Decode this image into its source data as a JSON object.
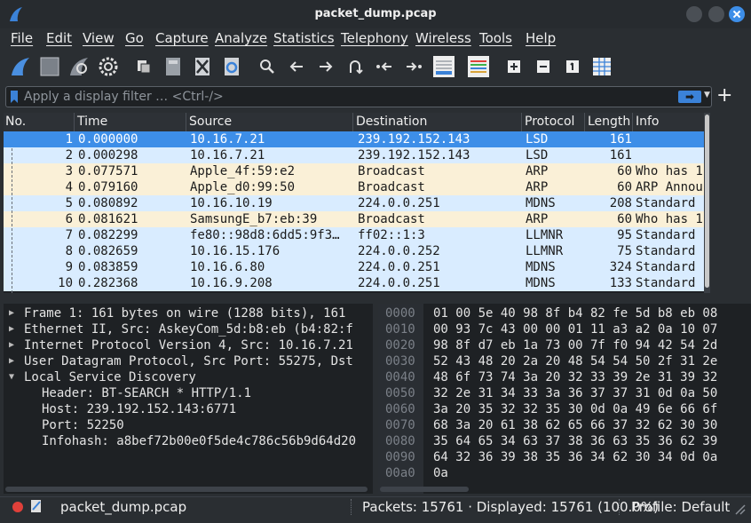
{
  "window": {
    "title": "packet_dump.pcap"
  },
  "menu": [
    "File",
    "Edit",
    "View",
    "Go",
    "Capture",
    "Analyze",
    "Statistics",
    "Telephony",
    "Wireless",
    "Tools",
    "Help"
  ],
  "toolbar": {
    "icons": [
      "shark-fin-start-icon",
      "stop-icon",
      "restart-icon",
      "options-gear-icon",
      "open-file-icon",
      "save-file-icon",
      "close-file-icon",
      "reload-file-icon",
      "search-icon",
      "back-arrow-icon",
      "forward-arrow-icon",
      "go-to-packet-icon",
      "first-packet-icon",
      "last-packet-icon",
      "autoscroll-icon",
      "colorize-icon",
      "zoom-in-icon",
      "zoom-out-icon",
      "normal-size-icon",
      "resize-columns-icon"
    ]
  },
  "filter": {
    "placeholder": "Apply a display filter … <Ctrl-/>",
    "value": "",
    "apply_glyph": "➡",
    "dropdown_glyph": "▼",
    "add_glyph": "+"
  },
  "packet_list": {
    "columns": [
      "No.",
      "Time",
      "Source",
      "Destination",
      "Protocol",
      "Length",
      "Info"
    ],
    "rows": [
      {
        "no": "1",
        "time": "0.000000",
        "src": "10.16.7.21",
        "dst": "239.192.152.143",
        "proto": "LSD",
        "len": "161",
        "info": ""
      },
      {
        "no": "2",
        "time": "0.000298",
        "src": "10.16.7.21",
        "dst": "239.192.152.143",
        "proto": "LSD",
        "len": "161",
        "info": ""
      },
      {
        "no": "3",
        "time": "0.077571",
        "src": "Apple_4f:59:e2",
        "dst": "Broadcast",
        "proto": "ARP",
        "len": "60",
        "info": "Who has 1"
      },
      {
        "no": "4",
        "time": "0.079160",
        "src": "Apple_d0:99:50",
        "dst": "Broadcast",
        "proto": "ARP",
        "len": "60",
        "info": "ARP Annou"
      },
      {
        "no": "5",
        "time": "0.080892",
        "src": "10.16.10.19",
        "dst": "224.0.0.251",
        "proto": "MDNS",
        "len": "208",
        "info": "Standard"
      },
      {
        "no": "6",
        "time": "0.081621",
        "src": "SamsungE_b7:eb:39",
        "dst": "Broadcast",
        "proto": "ARP",
        "len": "60",
        "info": "Who has 1"
      },
      {
        "no": "7",
        "time": "0.082299",
        "src": "fe80::98d8:6dd5:9f3…",
        "dst": "ff02::1:3",
        "proto": "LLMNR",
        "len": "95",
        "info": "Standard"
      },
      {
        "no": "8",
        "time": "0.082659",
        "src": "10.16.15.176",
        "dst": "224.0.0.252",
        "proto": "LLMNR",
        "len": "75",
        "info": "Standard"
      },
      {
        "no": "9",
        "time": "0.083859",
        "src": "10.16.6.80",
        "dst": "224.0.0.251",
        "proto": "MDNS",
        "len": "324",
        "info": "Standard"
      },
      {
        "no": "10",
        "time": "0.282368",
        "src": "10.16.9.208",
        "dst": "224.0.0.251",
        "proto": "MDNS",
        "len": "133",
        "info": "Standard"
      }
    ],
    "row_colors": {
      "selected": "#3d8ee8",
      "udp": "#d9ecff",
      "arp": "#faf0d7"
    }
  },
  "details": [
    {
      "arrow": "▶",
      "text": "Frame 1: 161 bytes on wire (1288 bits), 161",
      "child": false
    },
    {
      "arrow": "▶",
      "text": "Ethernet II, Src: AskeyCom_5d:b8:eb (b4:82:f",
      "child": false
    },
    {
      "arrow": "▶",
      "text": "Internet Protocol Version 4, Src: 10.16.7.21",
      "child": false
    },
    {
      "arrow": "▶",
      "text": "User Datagram Protocol, Src Port: 55275, Dst",
      "child": false
    },
    {
      "arrow": "▼",
      "text": "Local Service Discovery",
      "child": false
    },
    {
      "arrow": "",
      "text": "Header: BT-SEARCH * HTTP/1.1",
      "child": true
    },
    {
      "arrow": "",
      "text": "Host: 239.192.152.143:6771",
      "child": true
    },
    {
      "arrow": "",
      "text": "Port: 52250",
      "child": true
    },
    {
      "arrow": "",
      "text": "Infohash: a8bef72b00e0f5de4c786c56b9d64d20",
      "child": true
    }
  ],
  "bytes": [
    {
      "off": "0000",
      "hex": "01 00 5e 40 98 8f b4 82  fe 5d b8 eb 08"
    },
    {
      "off": "0010",
      "hex": "00 93 7c 43 00 00 01 11  a3 a2 0a 10 07"
    },
    {
      "off": "0020",
      "hex": "98 8f d7 eb 1a 73 00 7f  f0 94 42 54 2d"
    },
    {
      "off": "0030",
      "hex": "52 43 48 20 2a 20 48 54  54 50 2f 31 2e"
    },
    {
      "off": "0040",
      "hex": "48 6f 73 74 3a 20 32 33  39 2e 31 39 32"
    },
    {
      "off": "0050",
      "hex": "32 2e 31 34 33 3a 36 37  37 31 0d 0a 50"
    },
    {
      "off": "0060",
      "hex": "3a 20 35 32 32 35 30 0d  0a 49 6e 66 6f"
    },
    {
      "off": "0070",
      "hex": "68 3a 20 61 38 62 65 66  37 32 62 30 30"
    },
    {
      "off": "0080",
      "hex": "35 64 65 34 63 37 38 36  63 35 36 62 39"
    },
    {
      "off": "0090",
      "hex": "64 32 36 39 38 35 36 34  62 30 34 0d 0a"
    },
    {
      "off": "00a0",
      "hex": "0a"
    }
  ],
  "status": {
    "file": "packet_dump.pcap",
    "packets": "Packets: 15761 · Displayed: 15761 (100.0%)",
    "profile": "Profile: Default"
  }
}
